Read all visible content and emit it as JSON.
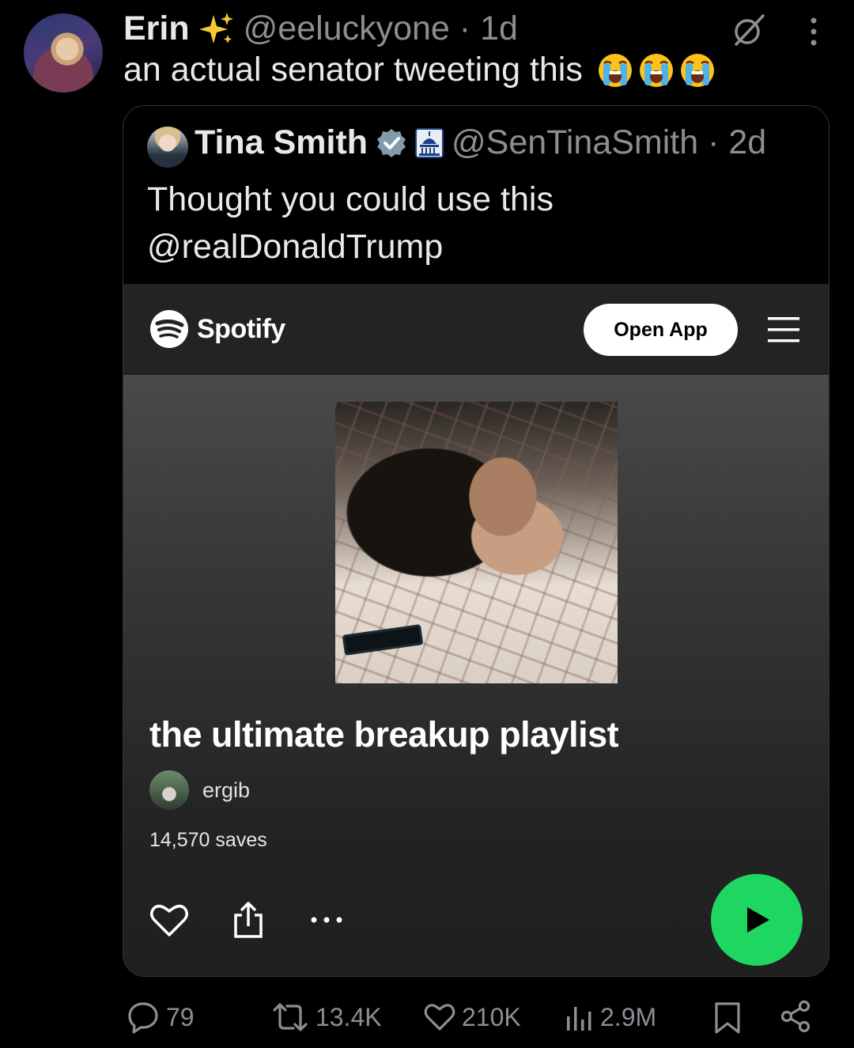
{
  "author": {
    "name": "Erin",
    "handle": "@eeluckyone",
    "time": "1d",
    "name_emoji": "sparkles-emoji"
  },
  "tweet": {
    "text": "an actual senator tweeting this",
    "emojis": [
      "loudly-crying-emoji",
      "loudly-crying-emoji",
      "loudly-crying-emoji"
    ]
  },
  "quoted": {
    "name": "Tina Smith",
    "handle": "@SenTinaSmith",
    "time": "2d",
    "text": "Thought you could use this @realDonaldTrump",
    "verified": true,
    "affiliation_icon": "capitol-icon"
  },
  "spotify": {
    "brand": "Spotify",
    "open_app_label": "Open App",
    "playlist_title": "the ultimate breakup playlist",
    "owner": "ergib",
    "saves": "14,570 saves",
    "accent": "#1ed760"
  },
  "actions": {
    "replies": "79",
    "retweets": "13.4K",
    "likes": "210K",
    "views": "2.9M"
  }
}
